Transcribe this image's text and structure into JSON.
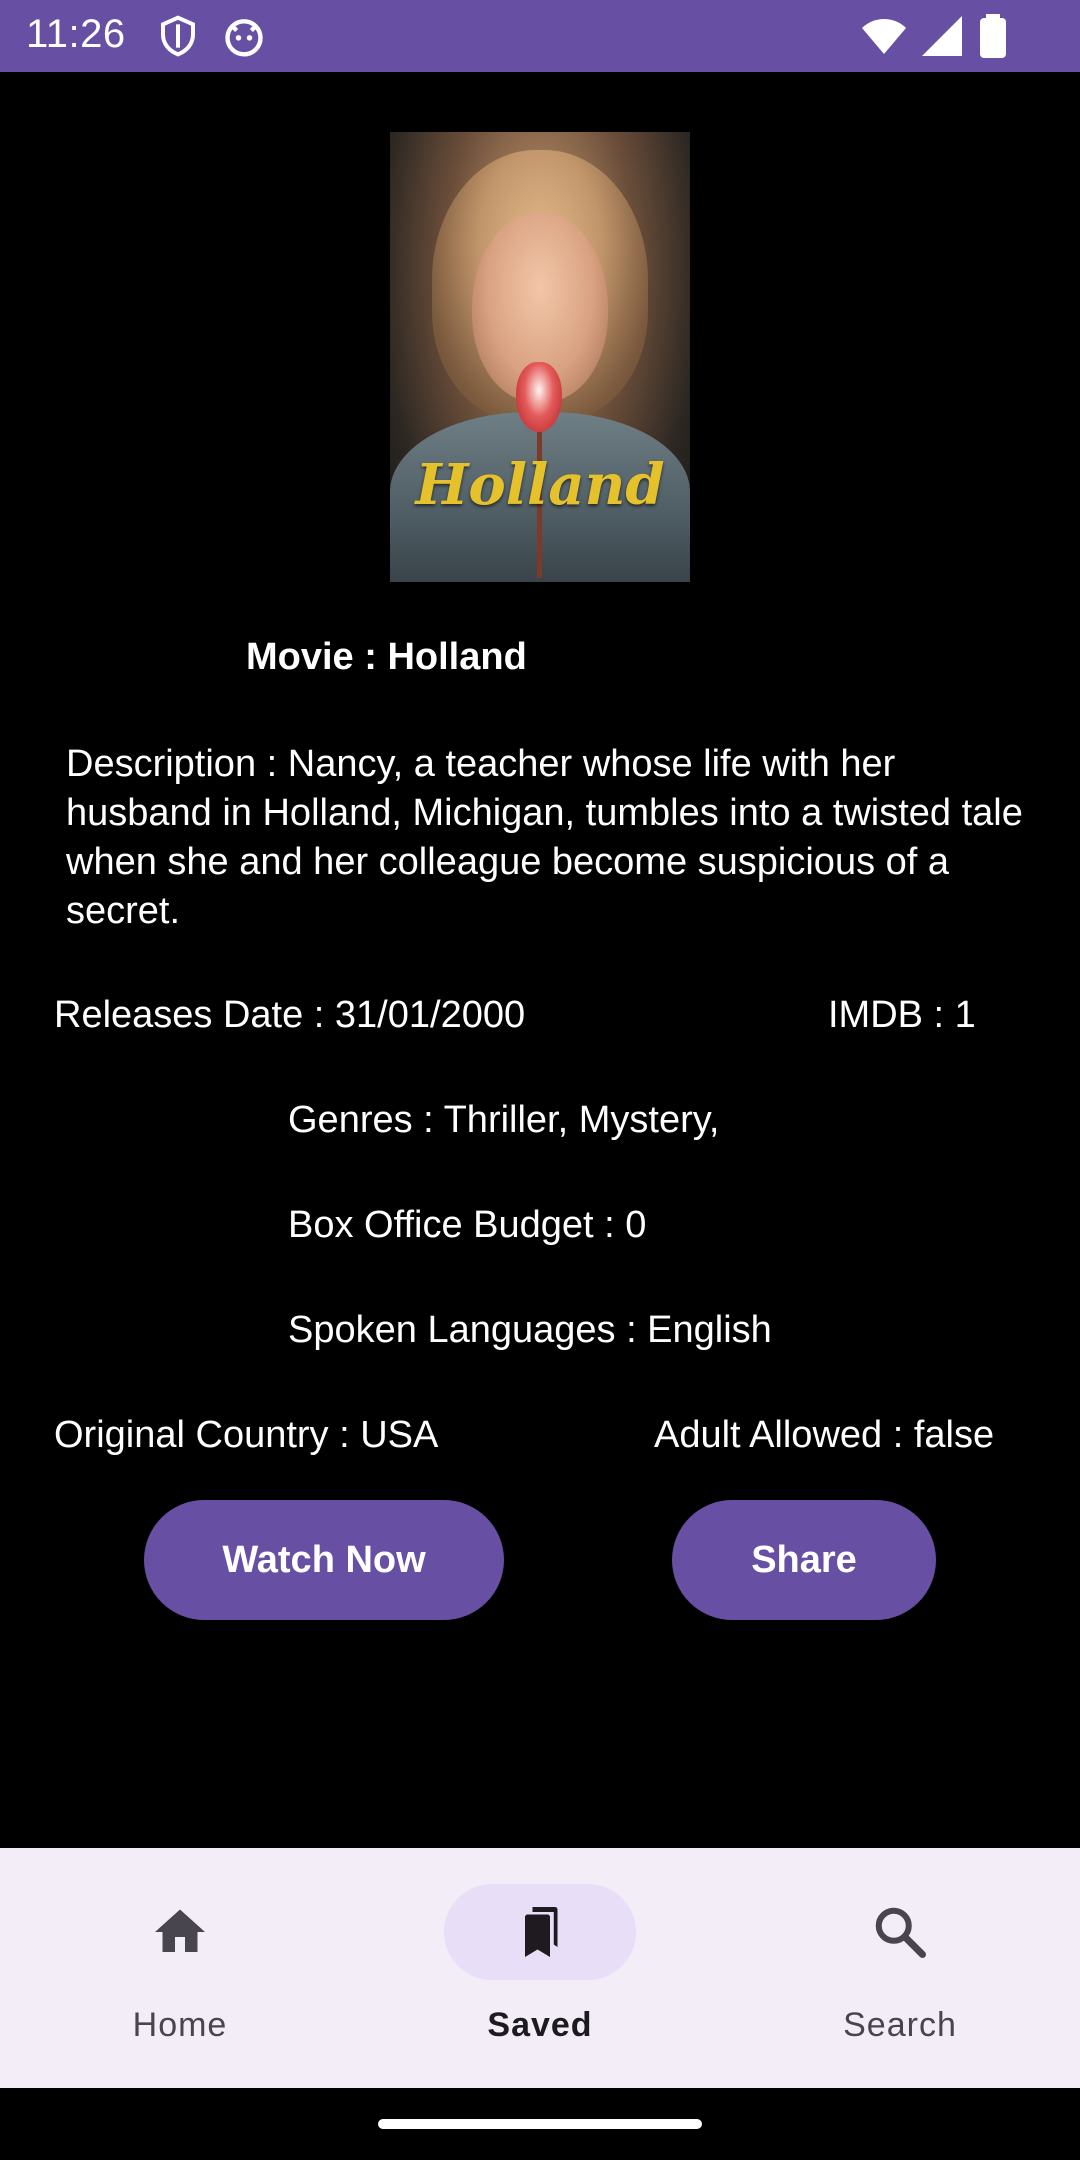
{
  "status_bar": {
    "time": "11:26"
  },
  "poster": {
    "title": "Holland"
  },
  "movie": {
    "title_line": "Movie : Holland",
    "description": "Description : Nancy, a teacher whose life with her husband in Holland, Michigan, tumbles into a twisted tale when she and her colleague become suspicious of a secret.",
    "release_date": "Releases Date : 31/01/2000",
    "imdb": "IMDB : 1",
    "genres": "Genres : Thriller, Mystery,",
    "budget": "Box Office Budget : 0",
    "languages": "Spoken Languages : English",
    "country": "Original Country : USA",
    "adult": "Adult Allowed : false"
  },
  "actions": {
    "watch_now": "Watch Now",
    "share": "Share"
  },
  "bottom_nav": {
    "items": [
      {
        "label": "Home",
        "icon": "home-icon",
        "active": false
      },
      {
        "label": "Saved",
        "icon": "bookmarks-icon",
        "active": true
      },
      {
        "label": "Search",
        "icon": "search-icon",
        "active": false
      }
    ]
  },
  "colors": {
    "accent": "#6750A4",
    "nav_bg": "#F3EDF7",
    "active_pill": "#E8DEF8",
    "poster_title": "#E5C22C"
  }
}
